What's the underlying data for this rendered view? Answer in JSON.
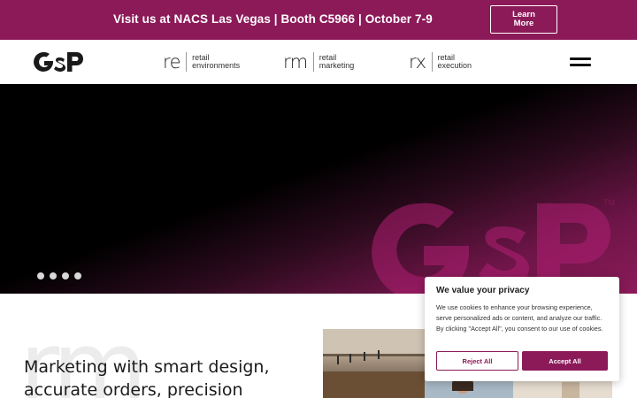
{
  "banner": {
    "text": "Visit us at NACS Las Vegas | Booth C5966 | October 7-9",
    "button_label": "Learn More"
  },
  "header": {
    "logo_text": "GSP",
    "divisions": [
      {
        "abbr": "re",
        "name_line1": "retail",
        "name_line2": "environments"
      },
      {
        "abbr": "rm",
        "name_line1": "retail",
        "name_line2": "marketing"
      },
      {
        "abbr": "rx",
        "name_line1": "retail",
        "name_line2": "execution"
      }
    ],
    "menu_icon": "hamburger-menu-icon"
  },
  "hero": {
    "watermark_text": "GSP",
    "trademark": "TM",
    "slide_count": 4
  },
  "content": {
    "background_word": "rm",
    "headline": "Marketing with smart design, accurate orders, precision"
  },
  "cookie_banner": {
    "title": "We value your privacy",
    "body": "We use cookies to enhance your browsing experience, serve personalized ads or content, and analyze our traffic. By clicking \"Accept All\", you consent to our use of cookies.",
    "reject_label": "Reject All",
    "accept_label": "Accept All"
  },
  "colors": {
    "brand": "#8c1a59",
    "text_dark": "#1b1b1b",
    "hero_black": "#000000"
  }
}
